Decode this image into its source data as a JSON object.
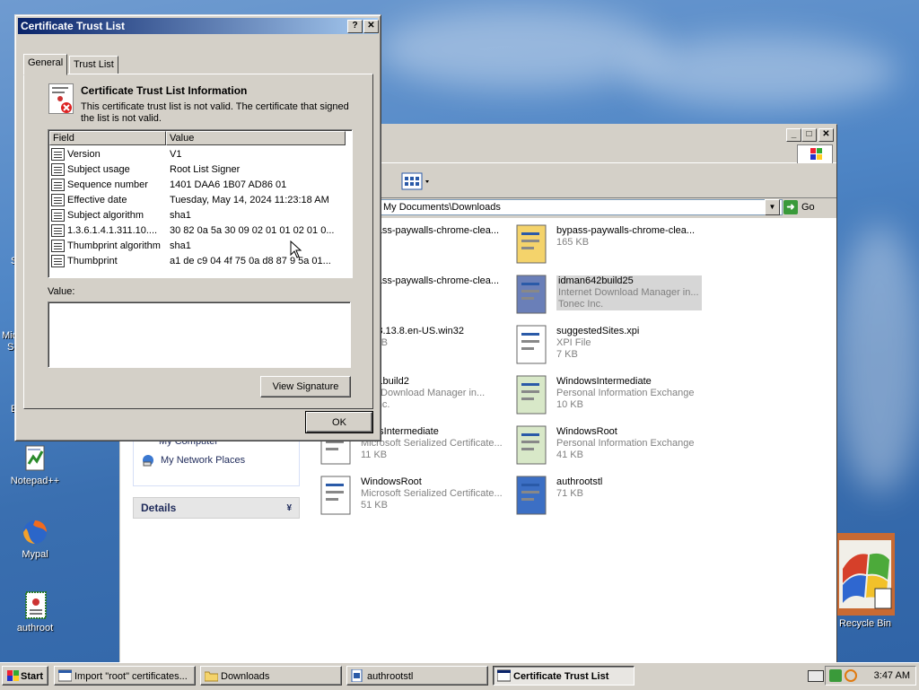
{
  "desktop": {
    "icons": [
      {
        "label": "Notepad++",
        "icon": "notepadpp-icon"
      },
      {
        "label": "Mypal",
        "icon": "mypal-browser-icon"
      },
      {
        "label": "authroot",
        "icon": "certificate-file-icon"
      },
      {
        "label": "Recycle Bin",
        "icon": "recycle-bin-icon"
      }
    ],
    "partial_labels": [
      "S",
      "Mic",
      "S",
      "E"
    ]
  },
  "explorer": {
    "title": "Downloads",
    "address": "My Documents\\Downloads",
    "go_label": "Go",
    "left_pane": {
      "cut_item": "My Computer",
      "network_places": "My Network Places",
      "details_header": "Details"
    },
    "files": [
      {
        "name": "bypass-paywalls-chrome-clea...",
        "line2": "se",
        "line3": "KB",
        "icon": "zip-folder-icon"
      },
      {
        "name": "bypass-paywalls-chrome-clea...",
        "line2": "165 KB",
        "line3": "",
        "icon": "zip-folder-icon"
      },
      {
        "name": "bypass-paywalls-chrome-clea...",
        "line2": "",
        "line3": "",
        "icon": "file-icon"
      },
      {
        "name": "idman642build25",
        "line2": "Internet Download Manager in...",
        "line3": "Tonec Inc.",
        "icon": "installer-icon",
        "selected": true
      },
      {
        "name": "al-68.13.8.en-US.win32",
        "line2": "23 KB",
        "line3": "",
        "icon": "file-icon"
      },
      {
        "name": "suggestedSites.xpi",
        "line2": "XPI File",
        "line3": "7 KB",
        "icon": "xpi-file-icon"
      },
      {
        "name": "n641build2",
        "line2": "rnet Download Manager in...",
        "line3": "ec Inc.",
        "icon": "installer-icon"
      },
      {
        "name": "WindowsIntermediate",
        "line2": "Personal Information Exchange",
        "line3": "10 KB",
        "icon": "pfx-file-icon"
      },
      {
        "name": "dowsIntermediate",
        "line2": "Microsoft Serialized Certificate...",
        "line3": "11 KB",
        "icon": "sst-file-icon"
      },
      {
        "name": "WindowsRoot",
        "line2": "Personal Information Exchange",
        "line3": "41 KB",
        "icon": "pfx-file-icon"
      },
      {
        "name": "WindowsRoot",
        "line2": "Microsoft Serialized Certificate...",
        "line3": "51 KB",
        "icon": "sst-file-icon"
      },
      {
        "name": "authrootstl",
        "line2": "71 KB",
        "line3": "",
        "icon": "stl-file-icon"
      }
    ]
  },
  "dialog": {
    "title": "Certificate Trust List",
    "help": "?",
    "close": "✕",
    "tabs": [
      "General",
      "Trust List"
    ],
    "info_title": "Certificate Trust List Information",
    "info_desc": "This certificate trust list is not valid.  The certificate that signed the list is not valid.",
    "columns": [
      "Field",
      "Value"
    ],
    "rows": [
      {
        "field": "Version",
        "value": "V1"
      },
      {
        "field": "Subject usage",
        "value": "Root List Signer"
      },
      {
        "field": "Sequence number",
        "value": "1401 DAA6 1B07 AD86 01"
      },
      {
        "field": "Effective date",
        "value": "Tuesday, May 14, 2024 11:23:18 AM"
      },
      {
        "field": "Subject algorithm",
        "value": "sha1"
      },
      {
        "field": "1.3.6.1.4.1.311.10....",
        "value": "30 82 0a 5a 30 09 02 01 01 02 01 0..."
      },
      {
        "field": "Thumbprint algorithm",
        "value": "sha1"
      },
      {
        "field": "Thumbprint",
        "value": "a1 de c9 04 4f 75 0a d8 87 9 5a 01..."
      }
    ],
    "value_label": "Value:",
    "view_signature": "View Signature",
    "ok": "OK"
  },
  "taskbar": {
    "start": "Start",
    "buttons": [
      {
        "label": "Import \"root\" certificates...",
        "icon": "browser-icon"
      },
      {
        "label": "Downloads",
        "icon": "folder-icon"
      },
      {
        "label": "authrootstl",
        "icon": "stl-file-icon"
      },
      {
        "label": "Certificate Trust List",
        "icon": "window-icon",
        "active": true
      }
    ],
    "clock": "3:47 AM"
  }
}
